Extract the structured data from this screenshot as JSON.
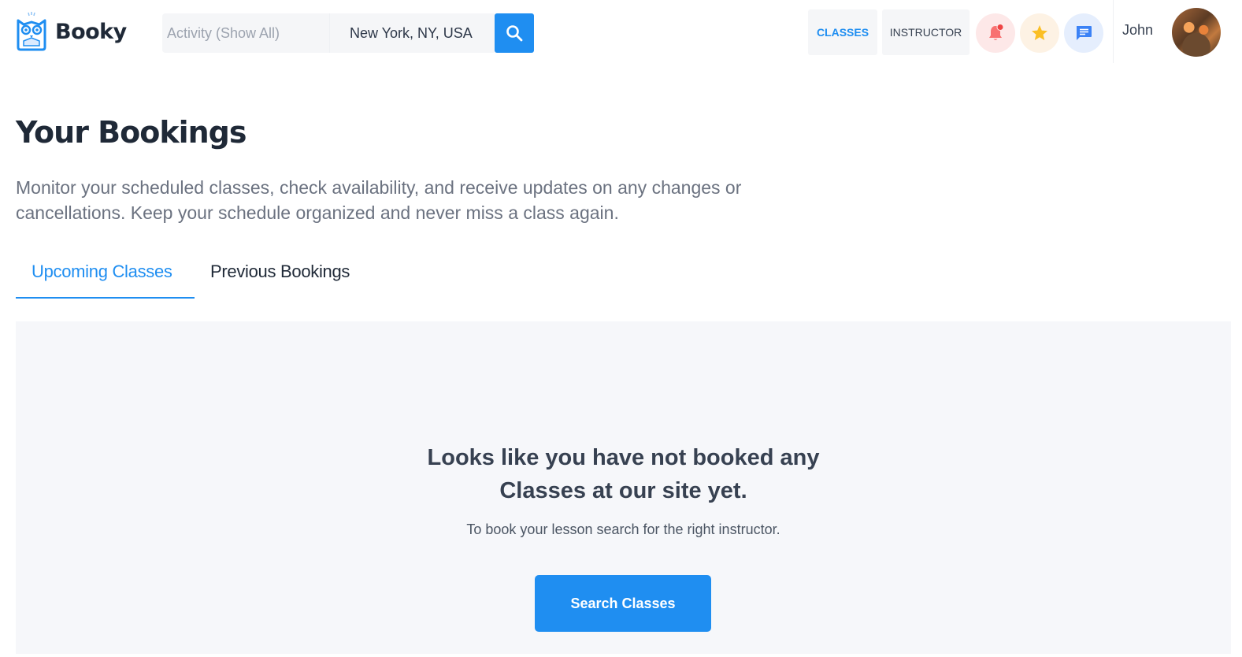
{
  "brand": {
    "name": "Booky",
    "accent": "#1f8ef1"
  },
  "search": {
    "activity_placeholder": "Activity (Show All)",
    "location_value": "New York, NY, USA",
    "button_icon": "search-icon"
  },
  "nav": {
    "classes_label": "CLASSES",
    "instructor_label": "INSTRUCTOR",
    "icons": [
      "bell-icon",
      "star-icon",
      "message-icon"
    ],
    "notification_dot_color": "#ef4444"
  },
  "user": {
    "name": "John"
  },
  "page": {
    "title": "Your Bookings",
    "description": "Monitor your scheduled classes, check availability, and receive updates on any changes or cancellations. Keep your schedule organized and never miss a class again."
  },
  "tabs": [
    {
      "label": "Upcoming Classes",
      "active": true
    },
    {
      "label": "Previous Bookings",
      "active": false
    }
  ],
  "empty_state": {
    "title_line1": "Looks like you have not booked any",
    "title_line2": "Classes at our site yet.",
    "subtitle": "To book your lesson search for the right instructor.",
    "button_label": "Search Classes"
  }
}
